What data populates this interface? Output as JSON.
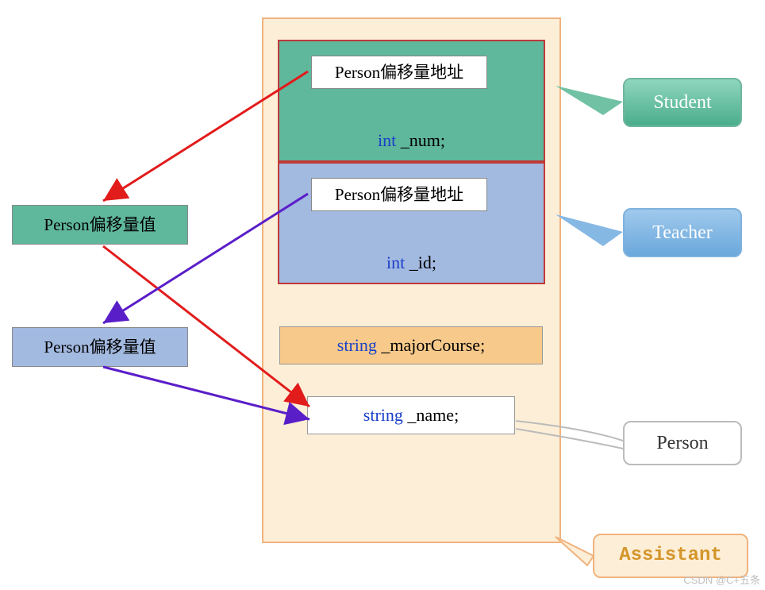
{
  "leftBoxes": {
    "green": "Person偏移量值",
    "blue": "Person偏移量值"
  },
  "student": {
    "addr": "Person偏移量地址",
    "type": "int",
    "var": "_num",
    "semi": ";"
  },
  "teacher": {
    "addr": "Person偏移量地址",
    "type": "int",
    "var": "_id",
    "semi": ";"
  },
  "majorCourse": {
    "type": "string",
    "var": "_majorCourse",
    "semi": ";"
  },
  "name": {
    "type": "string",
    "var": "_name",
    "semi": ";"
  },
  "labels": {
    "student": "Student",
    "teacher": "Teacher",
    "person": "Person",
    "assistant": "Assistant"
  },
  "watermark": "CSDN @C+五条"
}
